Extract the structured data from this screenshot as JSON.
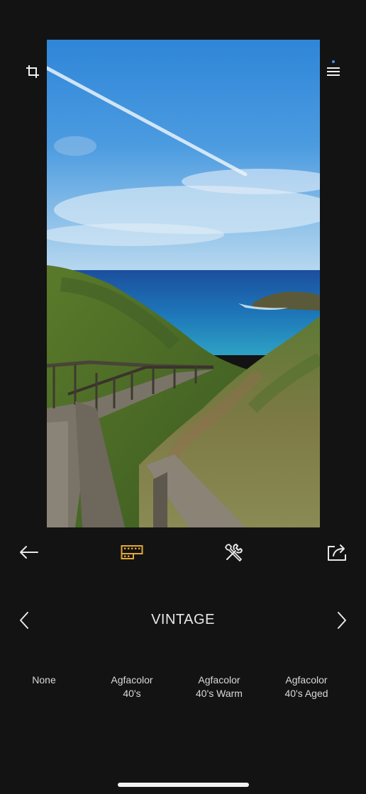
{
  "photo": {
    "description_icon": "landscape-photo"
  },
  "top_controls": {
    "crop_icon": "crop-icon",
    "menu_icon": "menu-icon"
  },
  "toolbar": {
    "back_icon": "arrow-left-icon",
    "filters_icon": "film-strip-icon",
    "tools_icon": "wrench-screwdriver-icon",
    "share_icon": "share-icon",
    "active_color": "#e0a93a"
  },
  "category": {
    "title": "VINTAGE",
    "prev_icon": "chevron-left-icon",
    "next_icon": "chevron-right-icon"
  },
  "filters": [
    {
      "line1": "None",
      "line2": ""
    },
    {
      "line1": "Agfacolor",
      "line2": "40's"
    },
    {
      "line1": "Agfacolor",
      "line2": "40's Warm"
    },
    {
      "line1": "Agfacolor",
      "line2": "40's Aged"
    }
  ]
}
